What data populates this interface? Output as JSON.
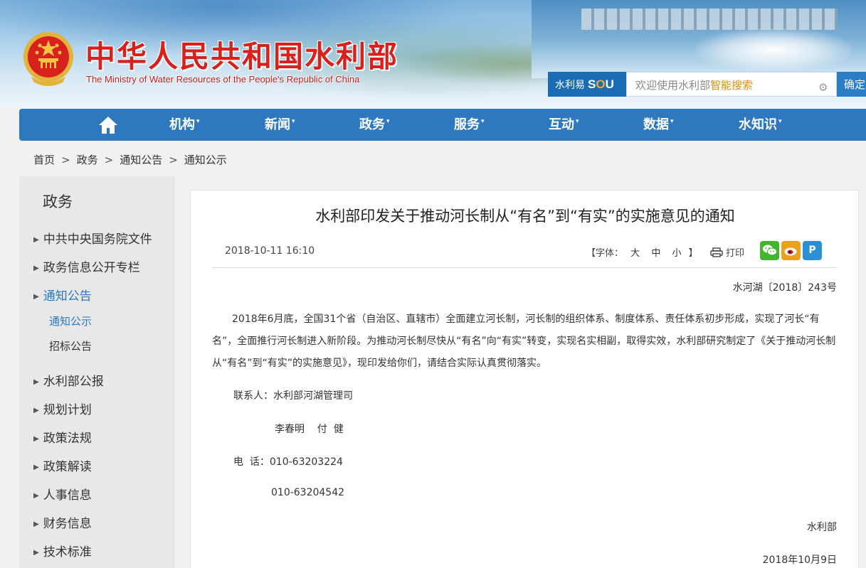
{
  "header": {
    "site_title": "中华人民共和国水利部",
    "site_subtitle": "The Ministry of Water Resources of the People's Republic of China",
    "search_brand_prefix": "水利易",
    "search_brand_s": "S",
    "search_brand_o": "O",
    "search_brand_u": "U",
    "search_placeholder_pre": "欢迎使用水利部",
    "search_placeholder_hl": "智能搜索",
    "search_button": "确定"
  },
  "nav": {
    "items": [
      {
        "label": "机构"
      },
      {
        "label": "新闻"
      },
      {
        "label": "政务"
      },
      {
        "label": "服务"
      },
      {
        "label": "互动"
      },
      {
        "label": "数据"
      },
      {
        "label": "水知识"
      }
    ],
    "caret": "▾"
  },
  "breadcrumb": [
    "首页",
    "政务",
    "通知公告",
    "通知公示"
  ],
  "breadcrumb_sep": ">",
  "sidebar": {
    "title": "政务",
    "items": [
      "中共中央国务院文件",
      "政务信息公开专栏",
      "通知公告",
      "水利部公报",
      "规划计划",
      "政策法规",
      "政策解读",
      "人事信息",
      "财务信息",
      "技术标准"
    ],
    "subitems": [
      "通知公示",
      "招标公告"
    ]
  },
  "article": {
    "title": "水利部印发关于推动河长制从“有名”到“有实”的实施意见的通知",
    "date": "2018-10-11 16:10",
    "font_label": "【字体：",
    "font_large": "大",
    "font_medium": "中",
    "font_small": "小",
    "font_close": "】",
    "print_label": "打印",
    "doc_number": "水河湖〔2018〕243号",
    "body": "2018年6月底，全国31个省（自治区、直辖市）全面建立河长制，河长制的组织体系、制度体系、责任体系初步形成，实现了河长“有名”，全面推行河长制进入新阶段。为推动河长制尽快从“有名”向“有实”转变，实现名实相副，取得实效，水利部研究制定了《关于推动河长制从“有名”到“有实”的实施意见》，现印发给你们，请结合实际认真贯彻落实。",
    "contact_label": "联系人：水利部河湖管理司",
    "contact_names": "李春明    付  健",
    "phone_label": "电  话：010-63203224",
    "phone2": "010-63204542",
    "signature": "水利部",
    "sign_date": "2018年10月9日"
  },
  "colors": {
    "nav_bg": "#2d78bf",
    "title_red": "#d8201c",
    "active_blue": "#2d78bf",
    "wechat": "#3fb62b",
    "weibo": "#e8a21c",
    "pinterest": "#2c8fd6"
  }
}
